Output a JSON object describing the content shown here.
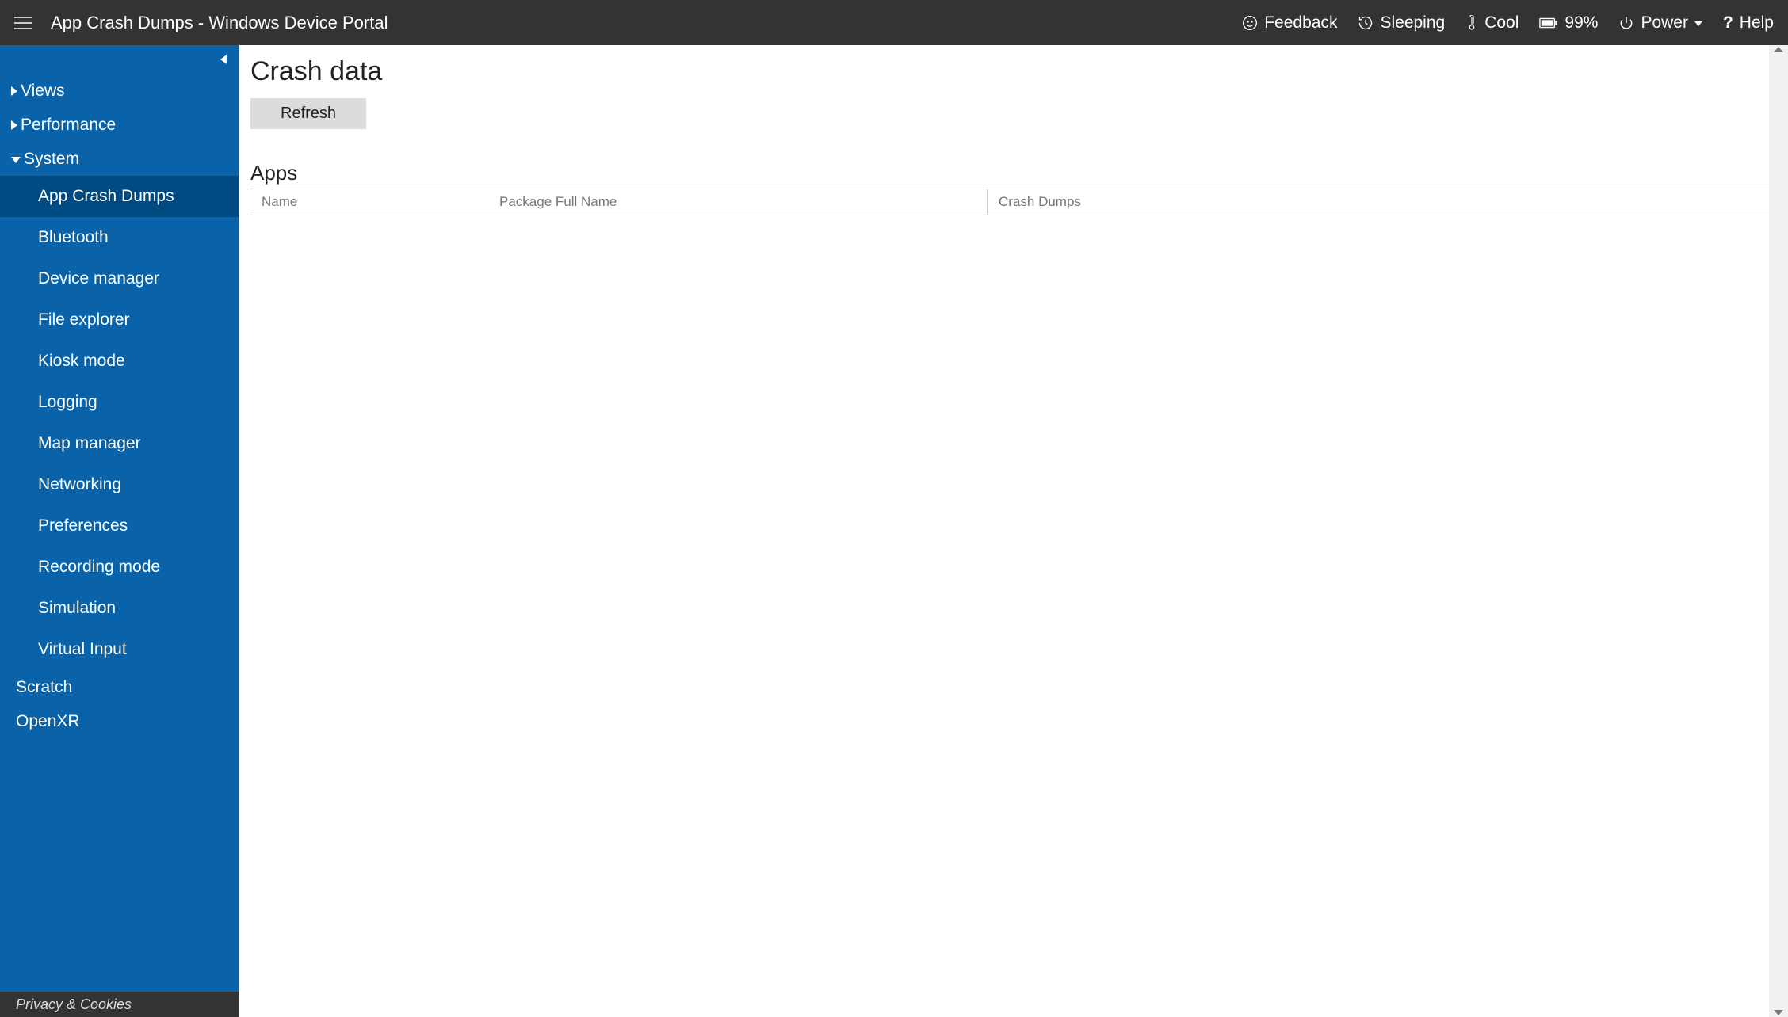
{
  "header": {
    "title": "App Crash Dumps - Windows Device Portal",
    "items": {
      "feedback": "Feedback",
      "sleeping": "Sleeping",
      "cool": "Cool",
      "battery": "99%",
      "power": "Power",
      "help": "Help"
    }
  },
  "sidebar": {
    "groups": {
      "views": "Views",
      "performance": "Performance",
      "system": "System"
    },
    "systemChildren": {
      "appCrashDumps": "App Crash Dumps",
      "bluetooth": "Bluetooth",
      "deviceManager": "Device manager",
      "fileExplorer": "File explorer",
      "kioskMode": "Kiosk mode",
      "logging": "Logging",
      "mapManager": "Map manager",
      "networking": "Networking",
      "preferences": "Preferences",
      "recordingMode": "Recording mode",
      "simulation": "Simulation",
      "virtualInput": "Virtual Input"
    },
    "flat": {
      "scratch": "Scratch",
      "openxr": "OpenXR"
    },
    "footer": "Privacy & Cookies"
  },
  "main": {
    "pageHeading": "Crash data",
    "refresh": "Refresh",
    "appsHeading": "Apps",
    "columns": {
      "name": "Name",
      "pkg": "Package Full Name",
      "crash": "Crash Dumps"
    }
  }
}
